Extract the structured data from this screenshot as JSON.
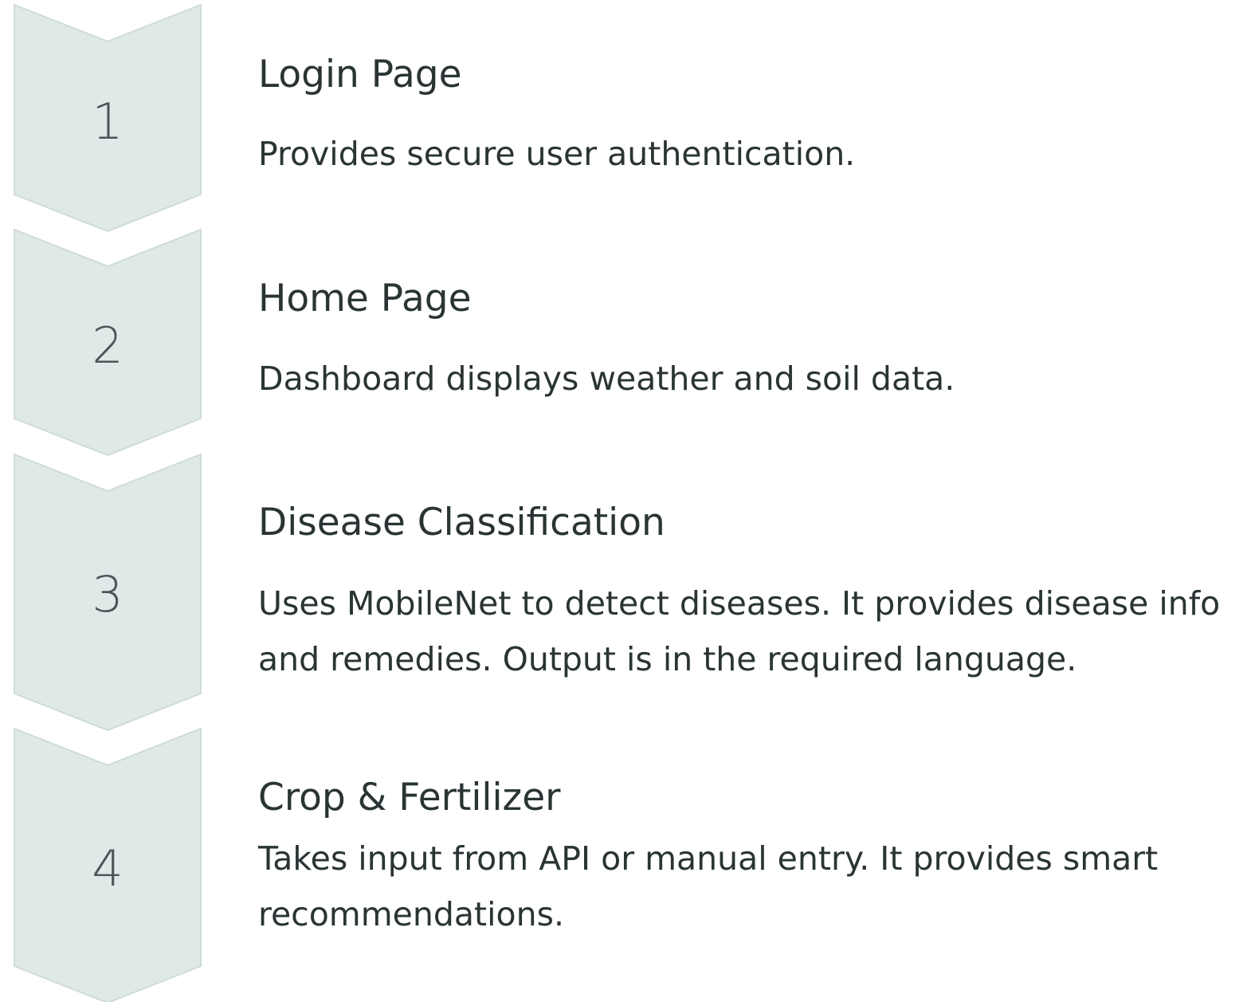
{
  "colors": {
    "chevron_fill": "#dfe9e7",
    "chevron_stroke": "#cfdcd9",
    "text": "#2a3434",
    "number": "#4a5656"
  },
  "steps": [
    {
      "number": "1",
      "title": "Login Page",
      "description": "Provides secure user authentication."
    },
    {
      "number": "2",
      "title": "Home Page",
      "description": "Dashboard displays weather and soil data."
    },
    {
      "number": "3",
      "title": "Disease Classification",
      "description": "Uses MobileNet to detect diseases. It provides disease info and remedies. Output is in the required language."
    },
    {
      "number": "4",
      "title": "Crop & Fertilizer",
      "description": "Takes input from API or manual entry. It provides smart recommendations."
    }
  ]
}
